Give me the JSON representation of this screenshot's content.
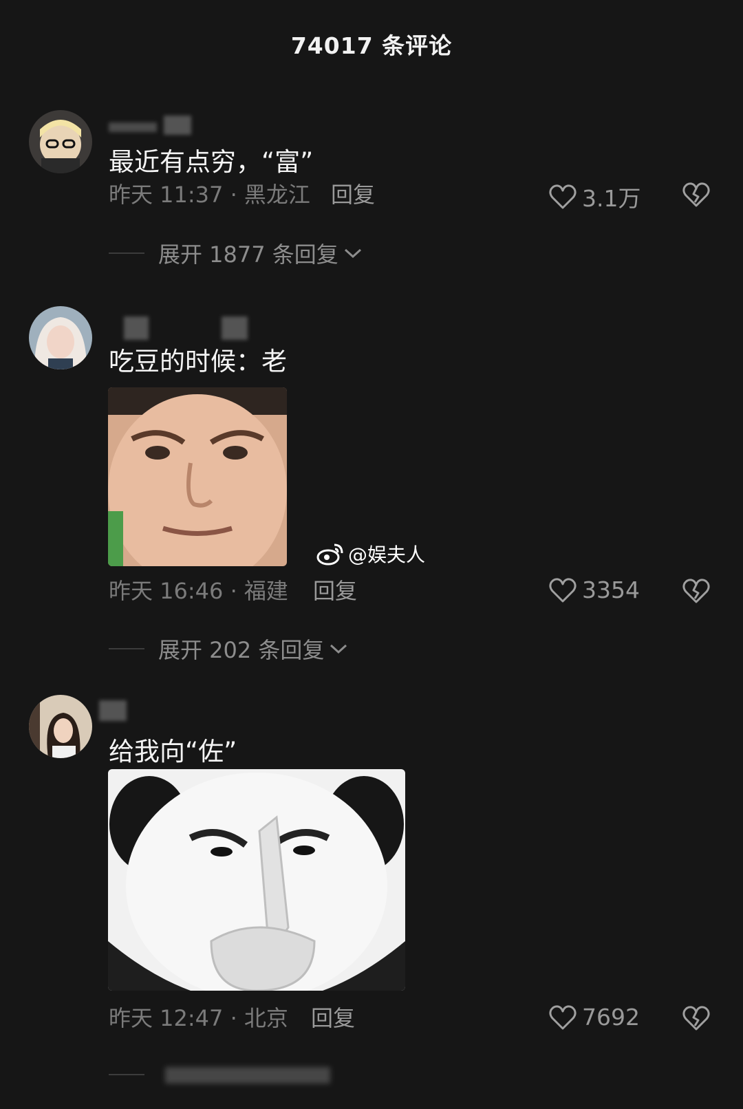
{
  "header": {
    "title": "74017 条评论"
  },
  "colors": {
    "background": "#161616",
    "text": "#f4f4f4",
    "meta": "#7b7b7b"
  },
  "comments": [
    {
      "text": "最近有点穷，“富”",
      "time_location": "昨天 11:37 · 黑龙江",
      "reply_label": "回复",
      "likes": "3.1万",
      "expand_label": "展开 1877 条回复"
    },
    {
      "text": "吃豆的时候：老",
      "time_location": "昨天 16:46 · 福建",
      "reply_label": "回复",
      "likes": "3354",
      "expand_label": "展开 202 条回复",
      "sticker_icon": "stern-face-sticker"
    },
    {
      "text": "给我向“佐”",
      "time_location": "昨天 12:47 · 北京",
      "reply_label": "回复",
      "likes": "7692",
      "sticker_icon": "panda-head-meme-sticker"
    }
  ],
  "watermark": {
    "text": "@娱夫人",
    "icon": "weibo-icon"
  }
}
